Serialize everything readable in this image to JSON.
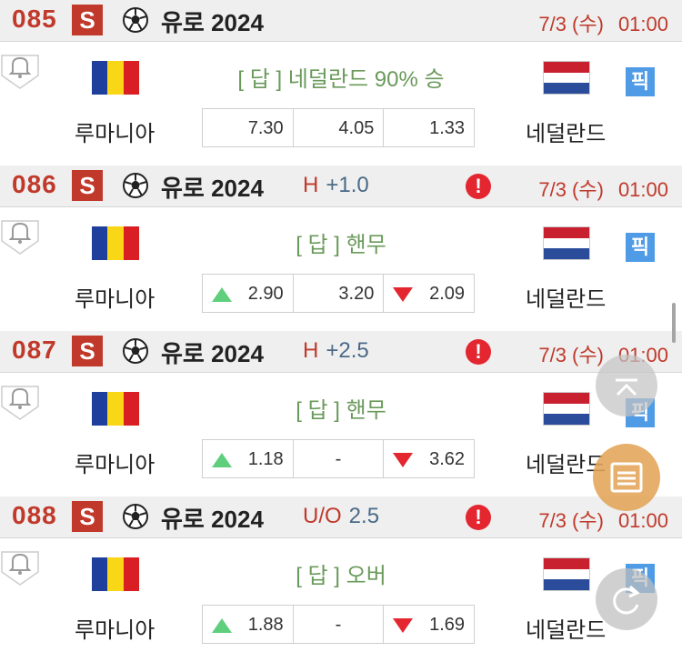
{
  "colors": {
    "accent_red": "#c0392b",
    "answer_green": "#6a9a5b",
    "handicap_blue": "#4a6a87",
    "pick_blue": "#4f9be6",
    "up_green": "#5fcf7d",
    "down_red": "#e3262f",
    "header_bg": "#efefef"
  },
  "matches": [
    {
      "number": "085",
      "sport_badge": "S",
      "league": "유로 2024",
      "handicap_type": "",
      "handicap_value": "",
      "has_alert": false,
      "date": "7/3 (수)",
      "time": "01:00",
      "answer": "[ 답 ]  네덜란드 90% 승",
      "home_team": "루마니아",
      "away_team": "네덜란드",
      "pick_label": "픽",
      "odds": [
        {
          "value": "7.30",
          "trend": "none"
        },
        {
          "value": "4.05",
          "trend": "none"
        },
        {
          "value": "1.33",
          "trend": "none"
        }
      ]
    },
    {
      "number": "086",
      "sport_badge": "S",
      "league": "유로 2024",
      "handicap_type": "H",
      "handicap_value": "+1.0",
      "has_alert": true,
      "alert_symbol": "!",
      "date": "7/3 (수)",
      "time": "01:00",
      "answer": "[ 답 ] 핸무",
      "home_team": "루마니아",
      "away_team": "네덜란드",
      "pick_label": "픽",
      "odds": [
        {
          "value": "2.90",
          "trend": "up"
        },
        {
          "value": "3.20",
          "trend": "none"
        },
        {
          "value": "2.09",
          "trend": "down"
        }
      ]
    },
    {
      "number": "087",
      "sport_badge": "S",
      "league": "유로 2024",
      "handicap_type": "H",
      "handicap_value": "+2.5",
      "has_alert": true,
      "alert_symbol": "!",
      "date": "7/3 (수)",
      "time": "01:00",
      "answer": "[ 답 ] 핸무",
      "home_team": "루마니아",
      "away_team": "네덜란드",
      "pick_label": "픽",
      "odds": [
        {
          "value": "1.18",
          "trend": "up"
        },
        {
          "value": "-",
          "trend": "none"
        },
        {
          "value": "3.62",
          "trend": "down"
        }
      ]
    },
    {
      "number": "088",
      "sport_badge": "S",
      "league": "유로 2024",
      "handicap_type": "U/O",
      "handicap_value": "2.5",
      "has_alert": true,
      "alert_symbol": "!",
      "date": "7/3 (수)",
      "time": "01:00",
      "answer": "[ 답 ] 오버",
      "home_team": "루마니아",
      "away_team": "네덜란드",
      "pick_label": "픽",
      "odds": [
        {
          "value": "1.88",
          "trend": "up"
        },
        {
          "value": "-",
          "trend": "none"
        },
        {
          "value": "1.69",
          "trend": "down"
        }
      ]
    }
  ],
  "floating_buttons": {
    "scroll_top_icon": "chevron-up-icon",
    "list_icon": "list-icon",
    "refresh_icon": "refresh-icon"
  }
}
